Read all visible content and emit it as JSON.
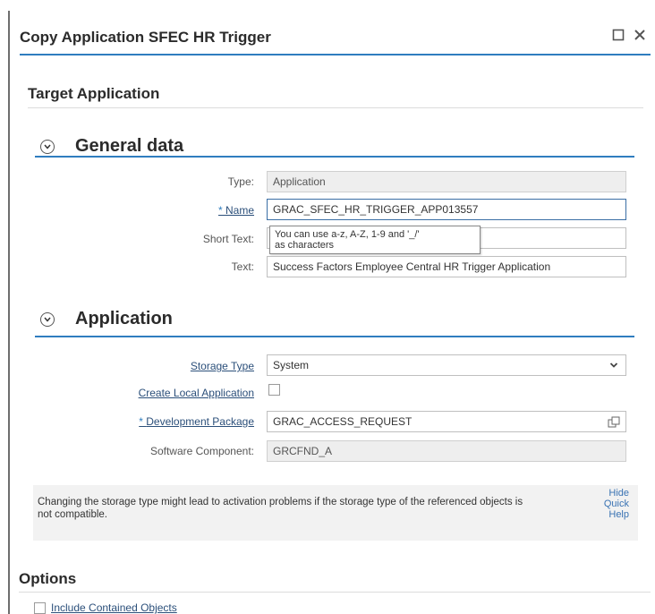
{
  "dialog": {
    "title": "Copy Application SFEC HR Trigger",
    "target_heading": "Target Application"
  },
  "general": {
    "heading": "General data",
    "type_label": "Type:",
    "type_value": "Application",
    "name_label": "Name",
    "name_value": "GRAC_SFEC_HR_TRIGGER_APP013557",
    "tooltip_line1": "You can use a-z, A-Z, 1-9 and '_/'",
    "tooltip_line2": "as characters",
    "short_text_label": "Short Text:",
    "short_text_value": "",
    "text_label": "Text:",
    "text_value": "Success Factors Employee Central HR Trigger Application"
  },
  "application": {
    "heading": "Application",
    "storage_type_label": "Storage Type",
    "storage_type_value": "System",
    "create_local_label": "Create Local Application",
    "create_local_checked": false,
    "dev_package_label": "Development Package",
    "dev_package_value": "GRAC_ACCESS_REQUEST",
    "software_component_label": "Software Component:",
    "software_component_value": "GRCFND_A"
  },
  "quick_help": {
    "text": "Changing the storage type might lead to activation problems if the storage type of the referenced objects is not compatible.",
    "hide_line1": "Hide",
    "hide_line2": "Quick",
    "hide_line3": "Help"
  },
  "options": {
    "heading": "Options",
    "include_contained_label": "Include Contained Objects",
    "include_contained_checked": false
  },
  "icons": {
    "maximize": "maximize-icon",
    "close": "close-icon",
    "collapse": "collapse-icon",
    "dropdown": "chevron-down-icon",
    "value_help": "value-help-icon"
  },
  "colors": {
    "accent": "#2f7dbf",
    "link": "#2b4f7a",
    "quick_help_link": "#3a73b3",
    "readonly_bg": "#eeeeee"
  }
}
